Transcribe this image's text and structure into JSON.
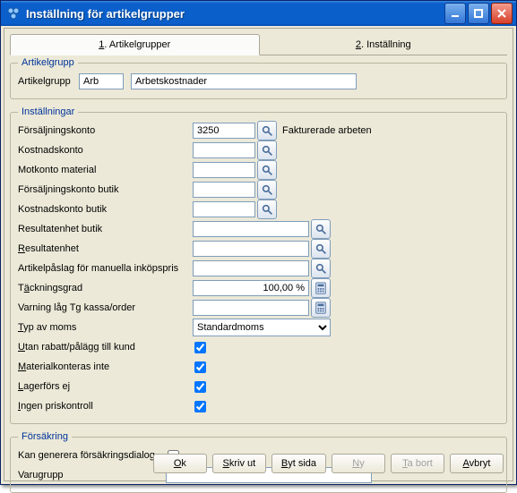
{
  "window": {
    "title": "Inställning för artikelgrupper"
  },
  "tabs": {
    "tab1_prefix": "1",
    "tab1_label": ". Artikelgrupper",
    "tab2_prefix": "2",
    "tab2_label": ". Inställning"
  },
  "group_artikelgrupp": {
    "legend": "Artikelgrupp",
    "label": "Artikelgrupp",
    "code": "Arb",
    "name": "Arbetskostnader"
  },
  "group_installningar": {
    "legend": "Inställningar",
    "forsaljningskonto_label": "Försäljningskonto",
    "forsaljningskonto_value": "3250",
    "forsaljningskonto_hint": "Fakturerade arbeten",
    "kostnadskonto_label": "Kostnadskonto",
    "kostnadskonto_value": "",
    "motkonto_label": "Motkonto material",
    "motkonto_value": "",
    "fk_butik_label": "Försäljningskonto butik",
    "fk_butik_value": "",
    "kk_butik_label": "Kostnadskonto butik",
    "kk_butik_value": "",
    "re_butik_label": "Resultatenhet butik",
    "re_butik_value": "",
    "re_label": "Resultatenhet",
    "re_value": "",
    "apaslag_label": "Artikelpåslag för manuella inköpspris",
    "apaslag_value": "",
    "tacknings_label": "Täckningsgrad",
    "tacknings_value": "100,00 %",
    "varning_label": "Varning låg Tg kassa/order",
    "varning_value": "",
    "moms_label": "Typ av moms",
    "moms_value": "Standardmoms",
    "utan_rabatt_label": "Utan rabatt/pålägg till kund",
    "utan_rabatt_checked": true,
    "matkont_label": "Materialkonteras inte",
    "matkont_checked": true,
    "lagerfor_label": "Lagerförs ej",
    "lagerfor_checked": true,
    "ingen_pk_label": "Ingen priskontroll",
    "ingen_pk_checked": true
  },
  "group_forsakring": {
    "legend": "Försäkring",
    "kan_gen_label": "Kan generera försäkringsdialog",
    "kan_gen_checked": false,
    "varugrupp_label": "Varugrupp",
    "varugrupp_value": ""
  },
  "buttons": {
    "ok_u": "O",
    "ok_rest": "k",
    "skriv_u": "S",
    "skriv_rest": "kriv ut",
    "bytsida_u": "B",
    "bytsida_rest": "yt sida",
    "ny_u": "N",
    "ny_rest": "y",
    "tabort_u": "T",
    "tabort_rest": "a bort",
    "avbryt_u": "A",
    "avbryt_rest": "vbryt"
  }
}
